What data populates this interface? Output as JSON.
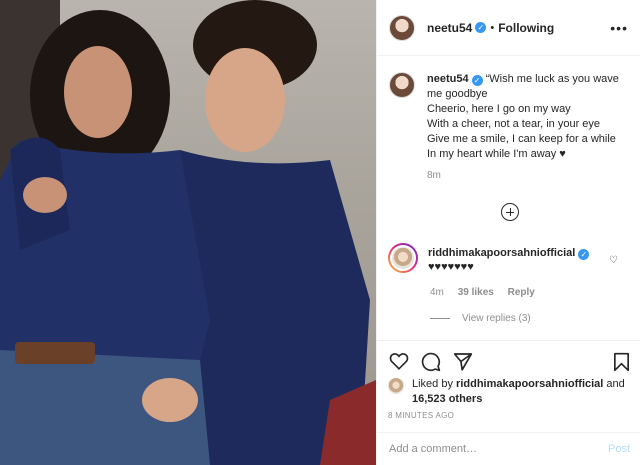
{
  "post": {
    "username": "neetu54",
    "follow_status": "Following",
    "more_icon": "more-dots-icon",
    "caption_lines": [
      "“Wish me luck as you wave me goodbye",
      "Cheerio, here I go on my way",
      "With a cheer, not a tear, in your eye",
      "Give me a smile, I can keep for a while",
      "In my heart while I'm away ♥"
    ],
    "caption_time": "8m"
  },
  "comment": {
    "username": "riddhimakapoorsahniofficial",
    "text": "♥♥♥♥♥♥♥",
    "time": "4m",
    "likes": "39 likes",
    "reply": "Reply",
    "view_replies": "View replies (3)"
  },
  "likes": {
    "prefix": "Liked by",
    "user": "riddhimakapoorsahniofficial",
    "and": "and",
    "others": "16,523 others"
  },
  "timestamp": "8 MINUTES AGO",
  "add_comment": {
    "placeholder": "Add a comment…",
    "post_label": "Post"
  },
  "colors": {
    "verified": "#3897f0",
    "post_disabled": "#b2dffc",
    "shirt": "#1f2a5c"
  }
}
